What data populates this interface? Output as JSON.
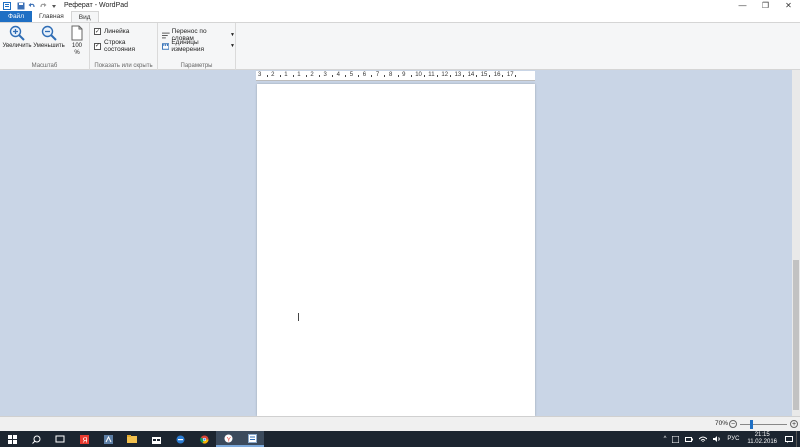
{
  "window": {
    "title": "Реферат - WordPad",
    "minimize": "—",
    "restore": "❐",
    "close": "✕"
  },
  "ribbon": {
    "tabs": [
      {
        "label": "Файл"
      },
      {
        "label": "Главная"
      },
      {
        "label": "Вид"
      }
    ],
    "zoom_group": {
      "label": "Масштаб",
      "zoom_in": "Увеличить",
      "zoom_out": "Уменьшить",
      "hundred": "100 %"
    },
    "show_group": {
      "label": "Показать или скрыть",
      "ruler": "Линейка",
      "ruler_checked": true,
      "statusbar": "Строка состояния",
      "statusbar_checked": true
    },
    "params_group": {
      "label": "Параметры",
      "word_wrap": "Перенос по словам",
      "units": "Единицы измерения"
    }
  },
  "ruler": {
    "labels": [
      "3",
      "2",
      "1",
      "1",
      "2",
      "3",
      "4",
      "5",
      "6",
      "7",
      "8",
      "9",
      "10",
      "11",
      "12",
      "13",
      "14",
      "15",
      "16",
      "17"
    ]
  },
  "statusbar": {
    "zoom_percent": "70%",
    "zoom_value": 70
  },
  "taskbar": {
    "language": "РУС",
    "time": "21:15",
    "date": "11.02.2016"
  },
  "colors": {
    "accent": "#1e6fc4",
    "workspace": "#c9d5e6",
    "taskbar": "#1c2530"
  }
}
